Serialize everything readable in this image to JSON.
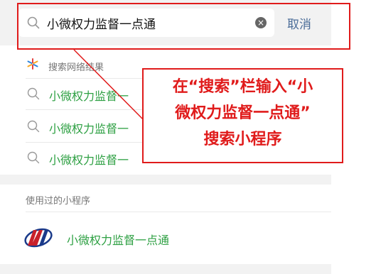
{
  "search": {
    "query": "小微权力监督一点通",
    "cancel_label": "取消",
    "clear_glyph": "×"
  },
  "web_results": {
    "heading": "搜索网络结果",
    "items": [
      {
        "label": "小微权力监督一"
      },
      {
        "label": "小微权力监督一"
      },
      {
        "label": "小微权力监督一"
      }
    ]
  },
  "used_programs": {
    "heading": "使用过的小程序",
    "items": [
      {
        "name": "小微权力监督一点通"
      }
    ]
  },
  "annotation": {
    "line1": "在“搜索”栏输入“小",
    "line2": "微权力监督一点通”",
    "line3": "搜索小程序"
  },
  "colors": {
    "accent_green": "#2ea043",
    "cancel_blue": "#4a6c98",
    "annotation_red": "#e01b1b"
  },
  "icons": {
    "search": "search-icon",
    "clear": "clear-icon",
    "web": "web-search-icon",
    "logo": "app-logo"
  }
}
